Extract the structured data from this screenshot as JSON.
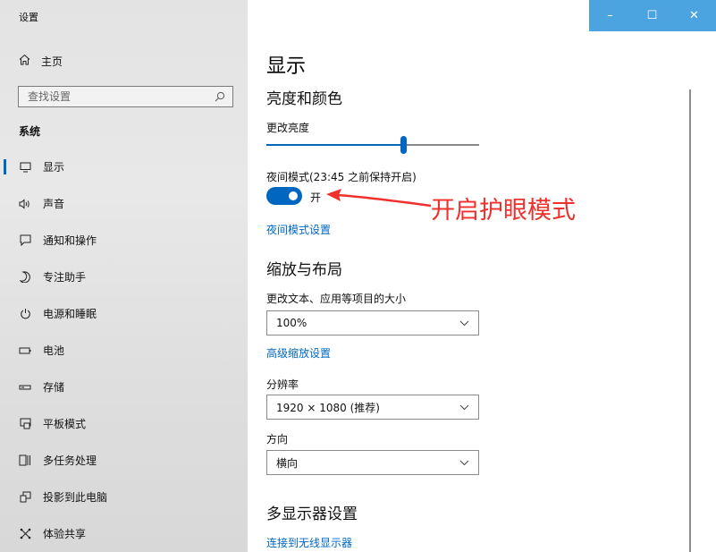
{
  "window": {
    "title": "设置",
    "controls": {
      "minimize": "–",
      "maximize": "☐",
      "close": "✕"
    },
    "titlebar_color": "#4ba3e0"
  },
  "sidebar": {
    "home_label": "主页",
    "search": {
      "placeholder": "查找设置"
    },
    "section_title": "系统",
    "items": [
      {
        "label": "显示",
        "icon": "monitor-icon",
        "active": true
      },
      {
        "label": "声音",
        "icon": "speaker-icon"
      },
      {
        "label": "通知和操作",
        "icon": "notification-icon"
      },
      {
        "label": "专注助手",
        "icon": "moon-icon"
      },
      {
        "label": "电源和睡眠",
        "icon": "power-icon"
      },
      {
        "label": "电池",
        "icon": "battery-icon"
      },
      {
        "label": "存储",
        "icon": "storage-icon"
      },
      {
        "label": "平板模式",
        "icon": "tablet-icon"
      },
      {
        "label": "多任务处理",
        "icon": "multitask-icon"
      },
      {
        "label": "投影到此电脑",
        "icon": "project-icon"
      },
      {
        "label": "体验共享",
        "icon": "share-icon"
      }
    ]
  },
  "main": {
    "title": "显示",
    "brightness_section": {
      "heading": "亮度和颜色",
      "brightness_label": "更改亮度",
      "brightness_level": 0.65,
      "night_light_label": "夜间模式(23:45 之前保持开启)",
      "night_light_state": "开",
      "night_light_on": true,
      "night_light_settings_link": "夜间模式设置"
    },
    "annotation": "开启护眼模式",
    "scale_section": {
      "heading": "缩放与布局",
      "scale_label": "更改文本、应用等项目的大小",
      "scale_value": "100%",
      "advanced_scale_link": "高级缩放设置",
      "resolution_label": "分辨率",
      "resolution_value": "1920 × 1080 (推荐)",
      "orientation_label": "方向",
      "orientation_value": "横向"
    },
    "multi_display": {
      "heading": "多显示器设置",
      "wireless_link": "连接到无线显示器"
    }
  },
  "colors": {
    "accent": "#0067c0",
    "annotation": "#f0302c"
  }
}
